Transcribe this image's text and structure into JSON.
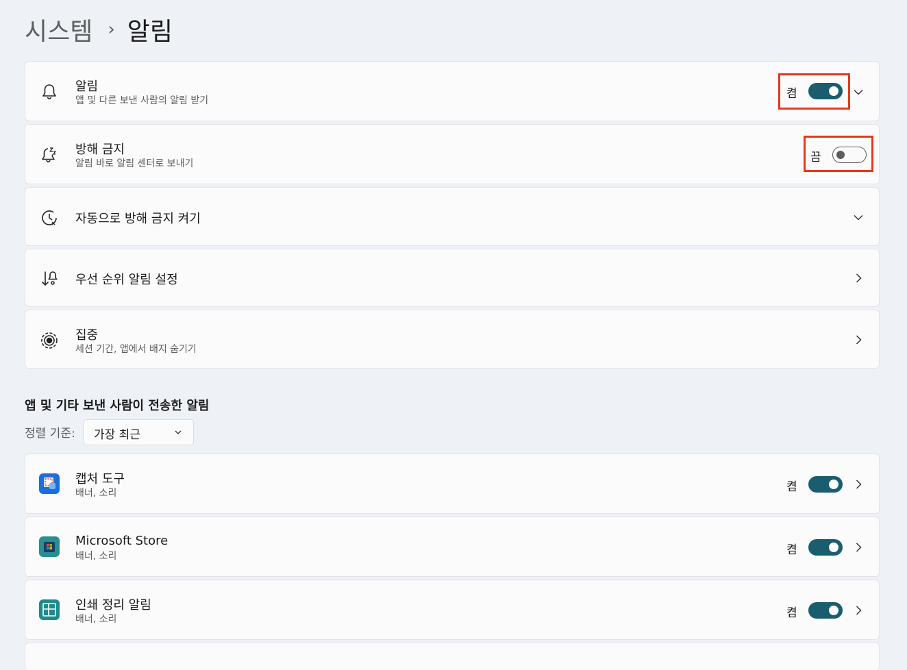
{
  "breadcrumb": {
    "parent": "시스템",
    "separator": "›",
    "current": "알림"
  },
  "settings": {
    "notifications": {
      "title": "알림",
      "subtitle": "앱 및 다른 보낸 사람의 알림 받기",
      "state": "켬",
      "icon": "bell-icon"
    },
    "dnd": {
      "title": "방해 금지",
      "subtitle": "알림 바로 알림 센터로 보내기",
      "state": "끔",
      "icon": "bell-snooze-icon"
    },
    "auto_dnd": {
      "title": "자동으로 방해 금지 켜기",
      "icon": "clock-icon"
    },
    "priority": {
      "title": "우선 순위 알림 설정",
      "icon": "priority-sort-icon"
    },
    "focus": {
      "title": "집중",
      "subtitle": "세션 기간, 앱에서 배지 숨기기",
      "icon": "focus-icon"
    }
  },
  "apps_section": {
    "title": "앱 및 기타 보낸 사람이 전송한 알림",
    "sort_label": "정렬 기준:",
    "sort_value": "가장 최근",
    "apps": [
      {
        "name": "캡처 도구",
        "detail": "배너, 소리",
        "state": "켬",
        "icon": "snipping-tool-icon"
      },
      {
        "name": "Microsoft Store",
        "detail": "배너, 소리",
        "state": "켬",
        "icon": "microsoft-store-icon"
      },
      {
        "name": "인쇄 정리 알림",
        "detail": "배너, 소리",
        "state": "켬",
        "icon": "print-cleanup-icon"
      }
    ]
  },
  "colors": {
    "toggle_on": "#1a5d6f",
    "highlight": "#e6371f",
    "background": "#eef1f6"
  }
}
